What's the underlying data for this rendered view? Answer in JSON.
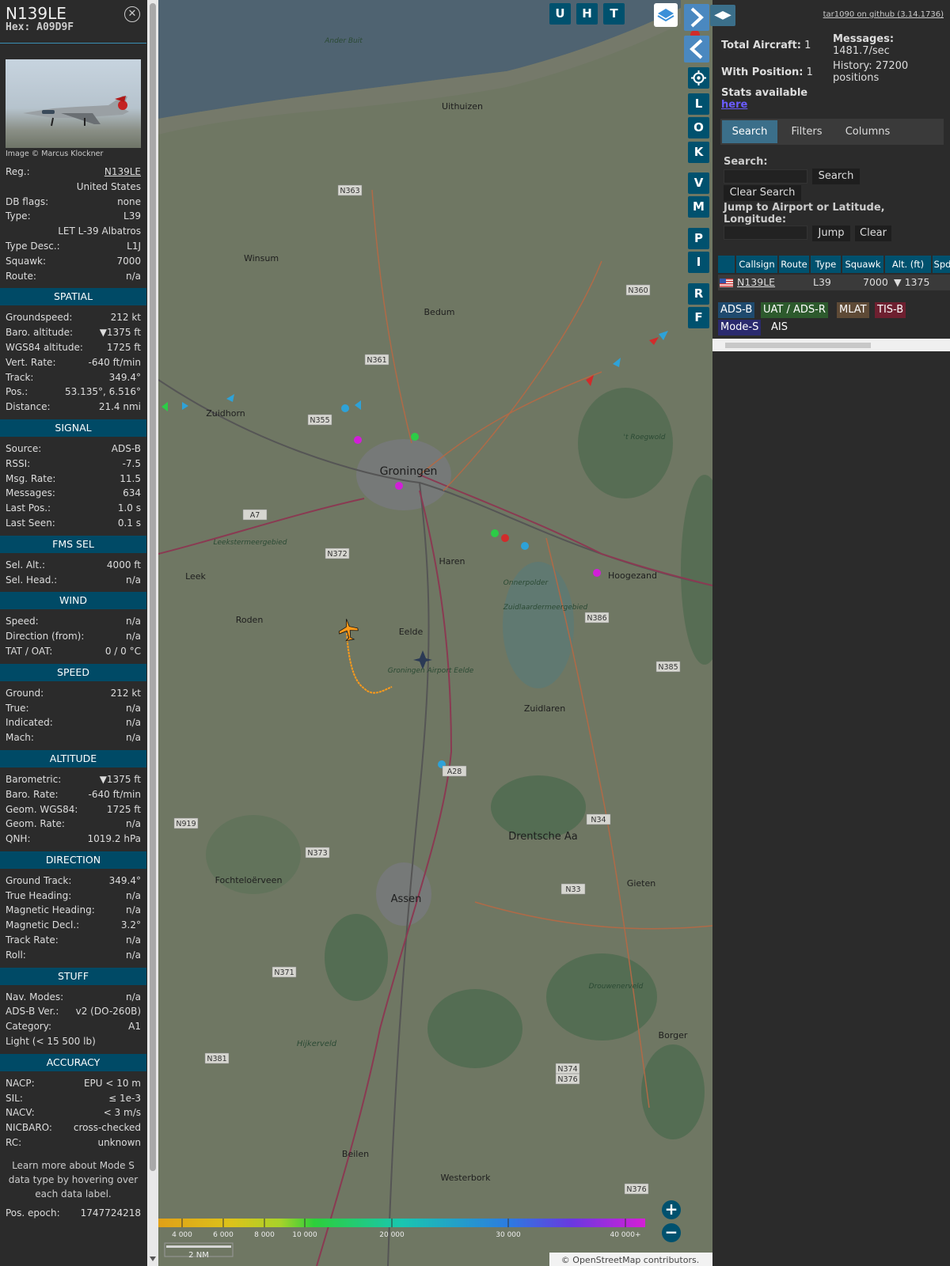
{
  "sidebar": {
    "callsign": "N139LE",
    "hex": "Hex: A09D9F",
    "photo_credit": "Image © Marcus Klockner",
    "general": [
      {
        "label": "Reg.:",
        "value": "N139LE",
        "link": true
      },
      {
        "label": "",
        "value": "United States"
      },
      {
        "label": "DB flags:",
        "value": "none"
      },
      {
        "label": "Type:",
        "value": "L39"
      },
      {
        "label": "",
        "value": "LET L-39 Albatros"
      },
      {
        "label": "Type Desc.:",
        "value": "L1J"
      },
      {
        "label": "Squawk:",
        "value": "7000"
      },
      {
        "label": "Route:",
        "value": "n/a"
      }
    ],
    "sections": [
      {
        "title": "SPATIAL",
        "rows": [
          {
            "label": "Groundspeed:",
            "value": "212 kt"
          },
          {
            "label": "Baro. altitude:",
            "value": "▼1375 ft"
          },
          {
            "label": "WGS84 altitude:",
            "value": "1725 ft"
          },
          {
            "label": "Vert. Rate:",
            "value": "-640 ft/min"
          },
          {
            "label": "Track:",
            "value": "349.4°"
          },
          {
            "label": "Pos.:",
            "value": "53.135°, 6.516°"
          },
          {
            "label": "Distance:",
            "value": "21.4 nmi"
          }
        ]
      },
      {
        "title": "SIGNAL",
        "rows": [
          {
            "label": "Source:",
            "value": "ADS-B"
          },
          {
            "label": "RSSI:",
            "value": "-7.5"
          },
          {
            "label": "Msg. Rate:",
            "value": "11.5"
          },
          {
            "label": "Messages:",
            "value": "634"
          },
          {
            "label": "Last Pos.:",
            "value": "1.0 s"
          },
          {
            "label": "Last Seen:",
            "value": "0.1 s"
          }
        ]
      },
      {
        "title": "FMS SEL",
        "rows": [
          {
            "label": "Sel. Alt.:",
            "value": "4000 ft"
          },
          {
            "label": "Sel. Head.:",
            "value": "n/a"
          }
        ]
      },
      {
        "title": "WIND",
        "rows": [
          {
            "label": "Speed:",
            "value": "n/a"
          },
          {
            "label": "Direction (from):",
            "value": "n/a"
          },
          {
            "label": "TAT / OAT:",
            "value": "0 / 0 °C"
          }
        ]
      },
      {
        "title": "SPEED",
        "rows": [
          {
            "label": "Ground:",
            "value": "212 kt"
          },
          {
            "label": "True:",
            "value": "n/a"
          },
          {
            "label": "Indicated:",
            "value": "n/a"
          },
          {
            "label": "Mach:",
            "value": "n/a"
          }
        ]
      },
      {
        "title": "ALTITUDE",
        "rows": [
          {
            "label": "Barometric:",
            "value": "▼1375 ft"
          },
          {
            "label": "Baro. Rate:",
            "value": "-640 ft/min"
          },
          {
            "label": "Geom. WGS84:",
            "value": "1725 ft"
          },
          {
            "label": "Geom. Rate:",
            "value": "n/a"
          },
          {
            "label": "QNH:",
            "value": "1019.2 hPa"
          }
        ]
      },
      {
        "title": "DIRECTION",
        "rows": [
          {
            "label": "Ground Track:",
            "value": "349.4°"
          },
          {
            "label": "True Heading:",
            "value": "n/a"
          },
          {
            "label": "Magnetic Heading:",
            "value": "n/a"
          },
          {
            "label": "Magnetic Decl.:",
            "value": "3.2°"
          },
          {
            "label": "Track Rate:",
            "value": "n/a"
          },
          {
            "label": "Roll:",
            "value": "n/a"
          }
        ]
      },
      {
        "title": "STUFF",
        "rows": [
          {
            "label": "Nav. Modes:",
            "value": "n/a"
          },
          {
            "label": "ADS-B Ver.:",
            "value": "v2 (DO-260B)"
          },
          {
            "label": "Category:",
            "value": "A1"
          },
          {
            "label": "Light (< 15 500 lb)",
            "value": ""
          }
        ]
      },
      {
        "title": "ACCURACY",
        "rows": [
          {
            "label": "NACP:",
            "value": "EPU < 10 m"
          },
          {
            "label": "SIL:",
            "value": "≤ 1e-3"
          },
          {
            "label": "NACV:",
            "value": "< 3 m/s"
          },
          {
            "label": "NICBARO:",
            "value": "cross-checked"
          },
          {
            "label": "RC:",
            "value": "unknown"
          }
        ]
      }
    ],
    "note": "Learn more about Mode S data type by hovering over each data label.",
    "pos_epoch_label": "Pos. epoch:",
    "pos_epoch_value": "1747724218"
  },
  "map_buttons": {
    "top": [
      "U",
      "H",
      "T"
    ],
    "side": [
      "L",
      "O",
      "K",
      "V",
      "M",
      "P",
      "I",
      "R",
      "F"
    ]
  },
  "map": {
    "places": [
      {
        "name": "Uithuizen"
      },
      {
        "name": "Winsum"
      },
      {
        "name": "Bedum"
      },
      {
        "name": "Zuidhorn"
      },
      {
        "name": "Groningen"
      },
      {
        "name": "Haren"
      },
      {
        "name": "Hoogezand"
      },
      {
        "name": "Leek"
      },
      {
        "name": "Roden"
      },
      {
        "name": "Eelde"
      },
      {
        "name": "Zuidlaren"
      },
      {
        "name": "Assen"
      },
      {
        "name": "Gieten"
      },
      {
        "name": "Borger"
      },
      {
        "name": "Beilen"
      },
      {
        "name": "Westerbork"
      },
      {
        "name": "Drentsche Aa"
      },
      {
        "name": "Fochteloërveen"
      },
      {
        "name": "Hijkerveld"
      },
      {
        "name": "Leekstermeergebied"
      },
      {
        "name": "Onnerpolder"
      },
      {
        "name": "Zuidlaardermeergebied"
      },
      {
        "name": "Drouwenerveld"
      },
      {
        "name": "Groningen Airport Eelde"
      },
      {
        "name": "Ander Buit"
      },
      {
        "name": "'t Roegwold"
      }
    ],
    "roads": [
      "N363",
      "N360",
      "N361",
      "N355",
      "A7",
      "N372",
      "N386",
      "N385",
      "A28",
      "N919",
      "N373",
      "N34",
      "N33",
      "N371",
      "N381",
      "N374",
      "N376",
      "N376"
    ],
    "scale_label": "2 NM",
    "legend_ticks": [
      "4 000",
      "6 000",
      "8 000",
      "10 000",
      "20 000",
      "30 000",
      "40 000+"
    ],
    "attribution": "© OpenStreetMap contributors.",
    "zoom_in": "+",
    "zoom_out": "−"
  },
  "panel": {
    "github_link": "tar1090 on github (3.14.1736)",
    "total_aircraft_label": "Total Aircraft:",
    "total_aircraft": "1",
    "with_position_label": "With Position:",
    "with_position": "1",
    "messages_label": "Messages:",
    "messages_value": "1481.7/sec",
    "history_label": "History: 27200",
    "history_value": "positions",
    "stats_label": "Stats available",
    "stats_link": "here",
    "tabs": [
      "Search",
      "Filters",
      "Columns"
    ],
    "search_label": "Search:",
    "search_button": "Search",
    "clear_search": "Clear Search",
    "jump_label": "Jump to Airport or Latitude, Longitude:",
    "jump_button": "Jump",
    "clear_button": "Clear",
    "columns": [
      "",
      "Callsign",
      "Route",
      "Type",
      "Squawk",
      "Alt. (ft)",
      "Spd"
    ],
    "row": {
      "callsign": "N139LE",
      "route": "",
      "type": "L39",
      "squawk": "7000",
      "alt": "▼ 1375"
    },
    "sources": [
      {
        "label": "ADS-B",
        "color": "#1f4a6e"
      },
      {
        "label": "UAT / ADS-R",
        "color": "#2d5a2d"
      },
      {
        "label": "MLAT",
        "color": "#5e4a36"
      },
      {
        "label": "TIS-B",
        "color": "#6e2030"
      },
      {
        "label": "Mode-S",
        "color": "#2a2a6e"
      },
      {
        "label": "AIS",
        "color": "#2b2b2b"
      }
    ]
  }
}
